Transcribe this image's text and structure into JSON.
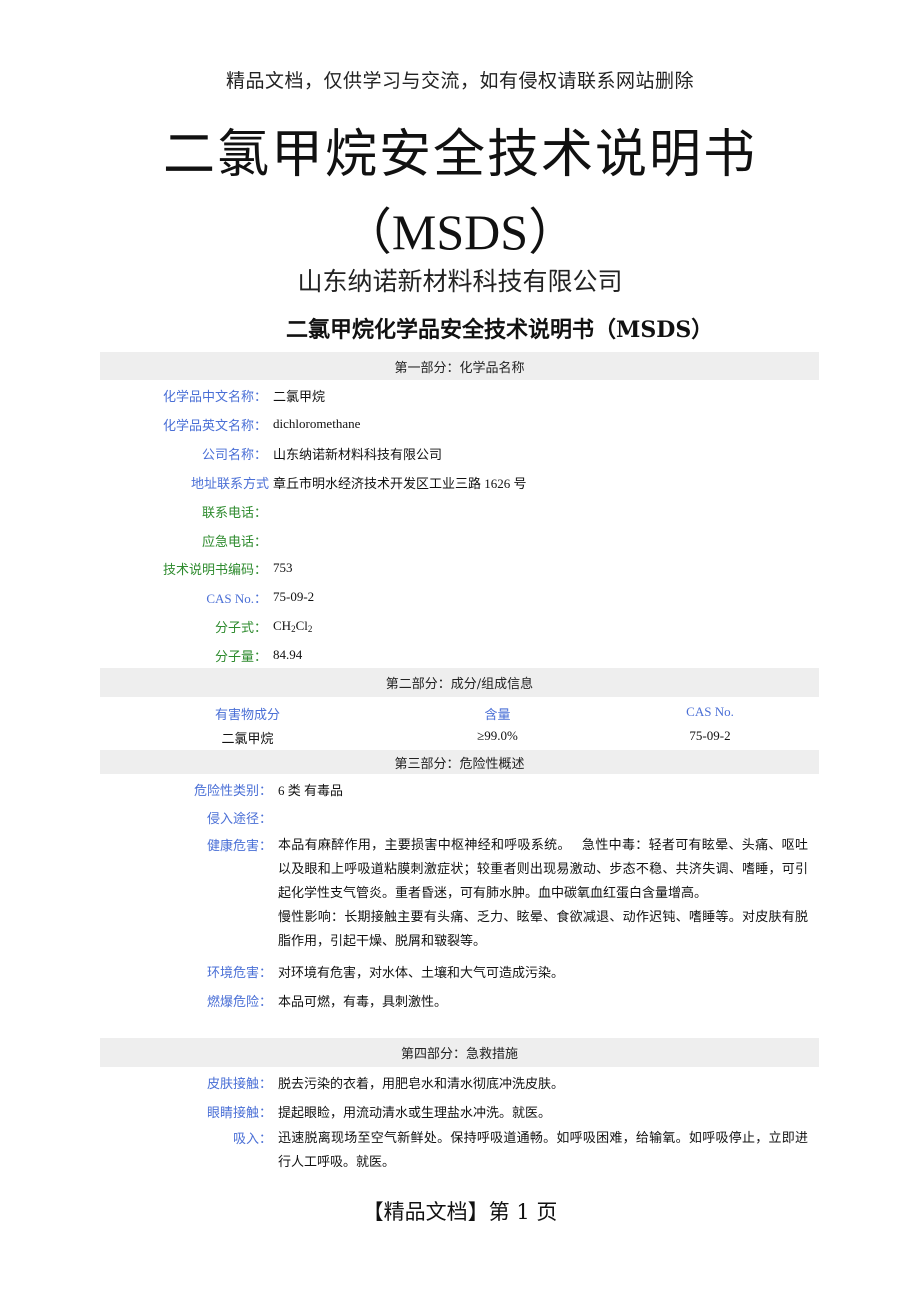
{
  "watermark": "精品文档，仅供学习与交流，如有侵权请联系网站删除",
  "title": {
    "main": "二氯甲烷安全技术说明书",
    "sub": "（MSDS）",
    "company": "山东纳诺新材料科技有限公司",
    "doc_title": "二氯甲烷化学品安全技术说明书（MSDS）"
  },
  "colors": {
    "label_blue": "#4a6fd6",
    "label_green": "#2e8b2e",
    "section_bg": "#eeeeee"
  },
  "section1": {
    "header": "第一部分：化学品名称",
    "fields": [
      {
        "label": "化学品中文名称：",
        "value": "二氯甲烷",
        "color": "blue"
      },
      {
        "label": "化学品英文名称：",
        "value": "dichloromethane",
        "color": "blue"
      },
      {
        "label": "公司名称：",
        "value": "山东纳诺新材料科技有限公司",
        "color": "blue"
      },
      {
        "label": "地址联系方式",
        "value": "章丘市明水经济技术开发区工业三路 1626 号",
        "color": "blue"
      },
      {
        "label": "联系电话：",
        "value": "",
        "color": "green"
      },
      {
        "label": "应急电话：",
        "value": "",
        "color": "green"
      },
      {
        "label": "技术说明书编码：",
        "value": "753",
        "color": "green"
      },
      {
        "label": "CAS No.：",
        "value": "75-09-2",
        "color": "blue"
      },
      {
        "label": "分子式：",
        "value_parts": [
          "CH",
          "2",
          "Cl",
          "2"
        ],
        "color": "green"
      },
      {
        "label": "分子量：",
        "value": "84.94",
        "color": "green"
      }
    ]
  },
  "section2": {
    "header": "第二部分：成分/组成信息",
    "columns": [
      "有害物成分",
      "含量",
      "CAS No."
    ],
    "rows": [
      [
        "二氯甲烷",
        "≥99.0%",
        "75-09-2"
      ]
    ]
  },
  "section3": {
    "header": "第三部分：危险性概述",
    "fields": [
      {
        "label": "危险性类别：",
        "value": "6 类  有毒品"
      },
      {
        "label": "侵入途径：",
        "value": ""
      },
      {
        "label": "健康危害：",
        "value": "本品有麻醉作用，主要损害中枢神经和呼吸系统。　 急性中毒：轻者可有眩晕、头痛、呕吐以及眼和上呼吸道粘膜刺激症状；较重者则出现易激动、步态不稳、共济失调、嗜睡，可引起化学性支气管炎。重者昏迷，可有肺水肿。血中碳氧血红蛋白含量增高。",
        "value2": "慢性影响：长期接触主要有头痛、乏力、眩晕、食欲减退、动作迟钝、嗜睡等。对皮肤有脱脂作用，引起干燥、脱屑和皲裂等。"
      },
      {
        "label": "环境危害：",
        "value": "对环境有危害，对水体、土壤和大气可造成污染。"
      },
      {
        "label": "燃爆危险：",
        "value": "本品可燃，有毒，具刺激性。"
      }
    ]
  },
  "section4": {
    "header": "第四部分：急救措施",
    "fields": [
      {
        "label": "皮肤接触：",
        "value": "脱去污染的衣着，用肥皂水和清水彻底冲洗皮肤。"
      },
      {
        "label": "眼睛接触：",
        "value": "提起眼睑，用流动清水或生理盐水冲洗。就医。"
      },
      {
        "label": "吸入：",
        "value": "迅速脱离现场至空气新鲜处。保持呼吸道通畅。如呼吸困难，给输氧。如呼吸停止，立即进行人工呼吸。就医。"
      }
    ]
  },
  "footer": "【精品文档】第  1  页"
}
